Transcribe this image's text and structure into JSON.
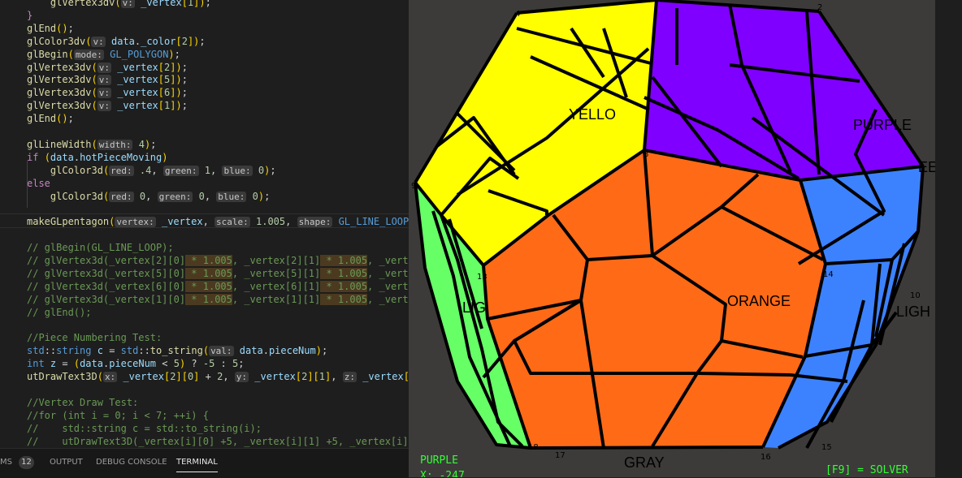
{
  "editor": {
    "lines": [
      {
        "segs": [
          {
            "t": "    "
          },
          {
            "t": "glVertex3dv",
            "c": "fn"
          },
          {
            "t": "(",
            "c": "pu"
          },
          {
            "t": "v:",
            "c": "hint"
          },
          {
            "t": " "
          },
          {
            "t": "_vertex",
            "c": "vr"
          },
          {
            "t": "[",
            "c": "pu"
          },
          {
            "t": "1",
            "c": "nm"
          },
          {
            "t": "]",
            "c": "pu"
          },
          {
            "t": ")",
            "c": "pu"
          },
          {
            "t": ";"
          }
        ]
      },
      {
        "segs": [
          {
            "t": "}",
            "c": "kw"
          }
        ]
      },
      {
        "segs": [
          {
            "t": "glEnd",
            "c": "fn"
          },
          {
            "t": "()",
            "c": "pu"
          },
          {
            "t": ";"
          }
        ]
      },
      {
        "segs": [
          {
            "t": "glColor3dv",
            "c": "fn"
          },
          {
            "t": "(",
            "c": "pu"
          },
          {
            "t": "v:",
            "c": "hint"
          },
          {
            "t": " "
          },
          {
            "t": "data",
            "c": "vr"
          },
          {
            "t": "."
          },
          {
            "t": "_color",
            "c": "vr"
          },
          {
            "t": "[",
            "c": "pu"
          },
          {
            "t": "2",
            "c": "nm"
          },
          {
            "t": "]",
            "c": "pu"
          },
          {
            "t": ")",
            "c": "pu"
          },
          {
            "t": ";"
          }
        ]
      },
      {
        "segs": [
          {
            "t": "glBegin",
            "c": "fn"
          },
          {
            "t": "(",
            "c": "pu"
          },
          {
            "t": "mode:",
            "c": "hint"
          },
          {
            "t": " "
          },
          {
            "t": "GL_POLYGON",
            "c": "ty"
          },
          {
            "t": ")",
            "c": "pu"
          },
          {
            "t": ";"
          }
        ]
      },
      {
        "segs": [
          {
            "t": "glVertex3dv",
            "c": "fn"
          },
          {
            "t": "(",
            "c": "pu"
          },
          {
            "t": "v:",
            "c": "hint"
          },
          {
            "t": " "
          },
          {
            "t": "_vertex",
            "c": "vr"
          },
          {
            "t": "[",
            "c": "pu"
          },
          {
            "t": "2",
            "c": "nm"
          },
          {
            "t": "]",
            "c": "pu"
          },
          {
            "t": ")",
            "c": "pu"
          },
          {
            "t": ";"
          }
        ]
      },
      {
        "segs": [
          {
            "t": "glVertex3dv",
            "c": "fn"
          },
          {
            "t": "(",
            "c": "pu"
          },
          {
            "t": "v:",
            "c": "hint"
          },
          {
            "t": " "
          },
          {
            "t": "_vertex",
            "c": "vr"
          },
          {
            "t": "[",
            "c": "pu"
          },
          {
            "t": "5",
            "c": "nm"
          },
          {
            "t": "]",
            "c": "pu"
          },
          {
            "t": ")",
            "c": "pu"
          },
          {
            "t": ";"
          }
        ]
      },
      {
        "segs": [
          {
            "t": "glVertex3dv",
            "c": "fn"
          },
          {
            "t": "(",
            "c": "pu"
          },
          {
            "t": "v:",
            "c": "hint"
          },
          {
            "t": " "
          },
          {
            "t": "_vertex",
            "c": "vr"
          },
          {
            "t": "[",
            "c": "pu"
          },
          {
            "t": "6",
            "c": "nm"
          },
          {
            "t": "]",
            "c": "pu"
          },
          {
            "t": ")",
            "c": "pu"
          },
          {
            "t": ";"
          }
        ]
      },
      {
        "segs": [
          {
            "t": "glVertex3dv",
            "c": "fn"
          },
          {
            "t": "(",
            "c": "pu"
          },
          {
            "t": "v:",
            "c": "hint"
          },
          {
            "t": " "
          },
          {
            "t": "_vertex",
            "c": "vr"
          },
          {
            "t": "[",
            "c": "pu"
          },
          {
            "t": "1",
            "c": "nm"
          },
          {
            "t": "]",
            "c": "pu"
          },
          {
            "t": ")",
            "c": "pu"
          },
          {
            "t": ";"
          }
        ]
      },
      {
        "segs": [
          {
            "t": "glEnd",
            "c": "fn"
          },
          {
            "t": "()",
            "c": "pu"
          },
          {
            "t": ";"
          }
        ]
      },
      {
        "segs": []
      },
      {
        "segs": [
          {
            "t": "glLineWidth",
            "c": "fn"
          },
          {
            "t": "(",
            "c": "pu"
          },
          {
            "t": "width:",
            "c": "hint"
          },
          {
            "t": " "
          },
          {
            "t": "4",
            "c": "nm"
          },
          {
            "t": ")",
            "c": "pu"
          },
          {
            "t": ";"
          }
        ]
      },
      {
        "segs": [
          {
            "t": "if",
            "c": "kw"
          },
          {
            "t": " "
          },
          {
            "t": "(",
            "c": "pu"
          },
          {
            "t": "data",
            "c": "vr"
          },
          {
            "t": "."
          },
          {
            "t": "hotPieceMoving",
            "c": "vr"
          },
          {
            "t": ")",
            "c": "pu"
          }
        ]
      },
      {
        "segs": [
          {
            "t": "    "
          },
          {
            "t": "glColor3d",
            "c": "fn"
          },
          {
            "t": "(",
            "c": "pu"
          },
          {
            "t": "red:",
            "c": "hint"
          },
          {
            "t": " "
          },
          {
            "t": ".4",
            "c": "nm"
          },
          {
            "t": ", "
          },
          {
            "t": "green:",
            "c": "hint"
          },
          {
            "t": " "
          },
          {
            "t": "1",
            "c": "nm"
          },
          {
            "t": ", "
          },
          {
            "t": "blue:",
            "c": "hint"
          },
          {
            "t": " "
          },
          {
            "t": "0",
            "c": "nm"
          },
          {
            "t": ")",
            "c": "pu"
          },
          {
            "t": ";"
          }
        ]
      },
      {
        "segs": [
          {
            "t": "else",
            "c": "kw"
          }
        ]
      },
      {
        "segs": [
          {
            "t": "    "
          },
          {
            "t": "glColor3d",
            "c": "fn"
          },
          {
            "t": "(",
            "c": "pu"
          },
          {
            "t": "red:",
            "c": "hint"
          },
          {
            "t": " "
          },
          {
            "t": "0",
            "c": "nm"
          },
          {
            "t": ", "
          },
          {
            "t": "green:",
            "c": "hint"
          },
          {
            "t": " "
          },
          {
            "t": "0",
            "c": "nm"
          },
          {
            "t": ", "
          },
          {
            "t": "blue:",
            "c": "hint"
          },
          {
            "t": " "
          },
          {
            "t": "0",
            "c": "nm"
          },
          {
            "t": ")",
            "c": "pu"
          },
          {
            "t": ";"
          }
        ]
      },
      {
        "segs": []
      },
      {
        "segs": [
          {
            "t": "makeGLpentagon",
            "c": "fn"
          },
          {
            "t": "(",
            "c": "pu"
          },
          {
            "t": "vertex:",
            "c": "hint"
          },
          {
            "t": " "
          },
          {
            "t": "_vertex",
            "c": "vr"
          },
          {
            "t": ", "
          },
          {
            "t": "scale:",
            "c": "hint"
          },
          {
            "t": " "
          },
          {
            "t": "1.005",
            "c": "nm"
          },
          {
            "t": ", "
          },
          {
            "t": "shape:",
            "c": "hint"
          },
          {
            "t": " "
          },
          {
            "t": "GL_LINE_LOOP",
            "c": "ty"
          },
          {
            "t": ")",
            "c": "pu"
          },
          {
            "t": ";"
          }
        ]
      },
      {
        "segs": []
      },
      {
        "segs": [
          {
            "t": "// glBegin(GL_LINE_LOOP);",
            "c": "cm"
          }
        ]
      },
      {
        "segs": [
          {
            "t": "// glVertex3d(_vertex[2][0]",
            "c": "cm"
          },
          {
            "t": " * 1.005",
            "c": "cm hl"
          },
          {
            "t": ", _vertex[2][1]",
            "c": "cm"
          },
          {
            "t": " * 1.005",
            "c": "cm hl"
          },
          {
            "t": ", _vertex",
            "c": "cm"
          }
        ]
      },
      {
        "segs": [
          {
            "t": "// glVertex3d(_vertex[5][0]",
            "c": "cm"
          },
          {
            "t": " * 1.005",
            "c": "cm hl"
          },
          {
            "t": ", _vertex[5][1]",
            "c": "cm"
          },
          {
            "t": " * 1.005",
            "c": "cm hl"
          },
          {
            "t": ", _vertex",
            "c": "cm"
          }
        ]
      },
      {
        "segs": [
          {
            "t": "// glVertex3d(_vertex[6][0]",
            "c": "cm"
          },
          {
            "t": " * 1.005",
            "c": "cm hl"
          },
          {
            "t": ", _vertex[6][1]",
            "c": "cm"
          },
          {
            "t": " * 1.005",
            "c": "cm hl"
          },
          {
            "t": ", _vertex",
            "c": "cm"
          }
        ]
      },
      {
        "segs": [
          {
            "t": "// glVertex3d(_vertex[1][0]",
            "c": "cm"
          },
          {
            "t": " * 1.005",
            "c": "cm hl"
          },
          {
            "t": ", _vertex[1][1]",
            "c": "cm"
          },
          {
            "t": " * 1.005",
            "c": "cm hl"
          },
          {
            "t": ", _vertex",
            "c": "cm"
          }
        ]
      },
      {
        "segs": [
          {
            "t": "// glEnd();",
            "c": "cm"
          }
        ]
      },
      {
        "segs": []
      },
      {
        "segs": [
          {
            "t": "//Piece Numbering Test:",
            "c": "cm"
          }
        ]
      },
      {
        "segs": [
          {
            "t": "std",
            "c": "ty"
          },
          {
            "t": "::"
          },
          {
            "t": "string",
            "c": "ty"
          },
          {
            "t": " "
          },
          {
            "t": "c",
            "c": "vr"
          },
          {
            "t": " = "
          },
          {
            "t": "std",
            "c": "ty"
          },
          {
            "t": "::"
          },
          {
            "t": "to_string",
            "c": "fn"
          },
          {
            "t": "(",
            "c": "pu"
          },
          {
            "t": "val:",
            "c": "hint"
          },
          {
            "t": " "
          },
          {
            "t": "data",
            "c": "vr"
          },
          {
            "t": "."
          },
          {
            "t": "pieceNum",
            "c": "vr"
          },
          {
            "t": ")",
            "c": "pu"
          },
          {
            "t": ";"
          }
        ]
      },
      {
        "segs": [
          {
            "t": "int",
            "c": "ty"
          },
          {
            "t": " "
          },
          {
            "t": "z",
            "c": "vr"
          },
          {
            "t": " = "
          },
          {
            "t": "(",
            "c": "pu"
          },
          {
            "t": "data",
            "c": "vr"
          },
          {
            "t": "."
          },
          {
            "t": "pieceNum",
            "c": "vr"
          },
          {
            "t": " < "
          },
          {
            "t": "5",
            "c": "nm"
          },
          {
            "t": ")",
            "c": "pu"
          },
          {
            "t": " ? "
          },
          {
            "t": "-5",
            "c": "nm"
          },
          {
            "t": " : "
          },
          {
            "t": "5",
            "c": "nm"
          },
          {
            "t": ";"
          }
        ]
      },
      {
        "segs": [
          {
            "t": "utDrawText3D",
            "c": "fn"
          },
          {
            "t": "(",
            "c": "pu"
          },
          {
            "t": "x:",
            "c": "hint"
          },
          {
            "t": " "
          },
          {
            "t": "_vertex",
            "c": "vr"
          },
          {
            "t": "[",
            "c": "pu"
          },
          {
            "t": "2",
            "c": "nm"
          },
          {
            "t": "]",
            "c": "pu"
          },
          {
            "t": "[",
            "c": "pu"
          },
          {
            "t": "0",
            "c": "nm"
          },
          {
            "t": "]",
            "c": "pu"
          },
          {
            "t": " + "
          },
          {
            "t": "2",
            "c": "nm"
          },
          {
            "t": ", "
          },
          {
            "t": "y:",
            "c": "hint"
          },
          {
            "t": " "
          },
          {
            "t": "_vertex",
            "c": "vr"
          },
          {
            "t": "[",
            "c": "pu"
          },
          {
            "t": "2",
            "c": "nm"
          },
          {
            "t": "]",
            "c": "pu"
          },
          {
            "t": "[",
            "c": "pu"
          },
          {
            "t": "1",
            "c": "nm"
          },
          {
            "t": "]",
            "c": "pu"
          },
          {
            "t": ", "
          },
          {
            "t": "z:",
            "c": "hint"
          },
          {
            "t": " "
          },
          {
            "t": "_vertex",
            "c": "vr"
          },
          {
            "t": "[",
            "c": "pu"
          },
          {
            "t": "2",
            "c": "nm"
          },
          {
            "t": "]",
            "c": "pu"
          },
          {
            "t": "[",
            "c": "pu"
          },
          {
            "t": "2",
            "c": "nm"
          }
        ]
      },
      {
        "segs": []
      },
      {
        "segs": [
          {
            "t": "//Vertex Draw Test:",
            "c": "cm"
          }
        ]
      },
      {
        "segs": [
          {
            "t": "//for (int i = 0; i < 7; ++i) {",
            "c": "cm"
          }
        ]
      },
      {
        "segs": [
          {
            "t": "//    std::string c = std::to_string(i);",
            "c": "cm"
          }
        ]
      },
      {
        "segs": [
          {
            "t": "//    utDrawText3D(_vertex[i][0] +5, _vertex[i][1] +5, _vertex[i][2",
            "c": "cm"
          }
        ]
      },
      {
        "segs": [
          {
            "t": "//}",
            "c": "cm"
          }
        ]
      }
    ]
  },
  "panel": {
    "tabs": [
      "MS",
      "OUTPUT",
      "DEBUG CONSOLE",
      "TERMINAL"
    ],
    "problems_count": "12",
    "active_tab": "TERMINAL"
  },
  "gl": {
    "face_labels": {
      "yellow": "YELLO",
      "purple": "PURPLE",
      "green_edge": "EE",
      "orange": "ORANGE",
      "light_green": "LIG",
      "light_blue": "LIGH",
      "gray": "GRAY"
    },
    "vertex_numbers": {
      "v4": "4",
      "v2": "2",
      "v8": "8",
      "v9": "9",
      "v13": "13",
      "v14": "14",
      "v10": "10",
      "v18": "18",
      "v17": "17",
      "v16": "16",
      "v15": "15"
    },
    "status": {
      "color_name": "PURPLE",
      "coord": "X: -247",
      "solver_hint": "[F9] = SOLVER"
    },
    "colors": {
      "yellow": "#ffff00",
      "purple": "#8000ff",
      "orange": "#ff6a16",
      "light_green": "#66ff66",
      "light_blue": "#3c82ff",
      "background": "#3c3b3a"
    }
  }
}
